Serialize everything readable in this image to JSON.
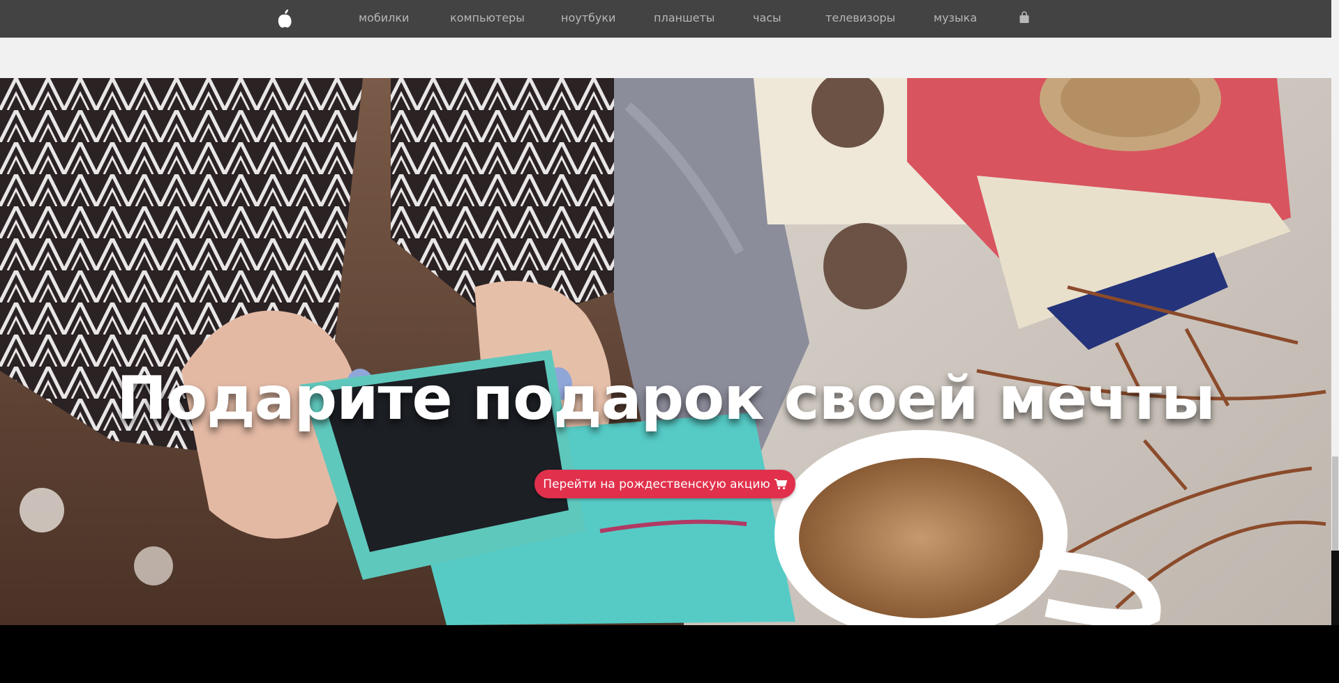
{
  "nav": {
    "logo_icon": "apple-logo-icon",
    "items": [
      {
        "label": "мобилки"
      },
      {
        "label": "компьютеры"
      },
      {
        "label": "ноутбуки"
      },
      {
        "label": "планшеты"
      },
      {
        "label": "часы"
      },
      {
        "label": "телевизоры"
      },
      {
        "label": "музыка"
      }
    ],
    "bag_icon": "shopping-bag-icon"
  },
  "hero": {
    "title": "Подарите подарок своей мечты",
    "cta_label": "Перейти на рождественскую акцию",
    "cta_icon": "cart-icon",
    "background": "hero-photo"
  },
  "colors": {
    "navbar": "#434343",
    "nav_text": "#b7b7b7",
    "band": "#f1f1f1",
    "cta": "#e1304b"
  }
}
